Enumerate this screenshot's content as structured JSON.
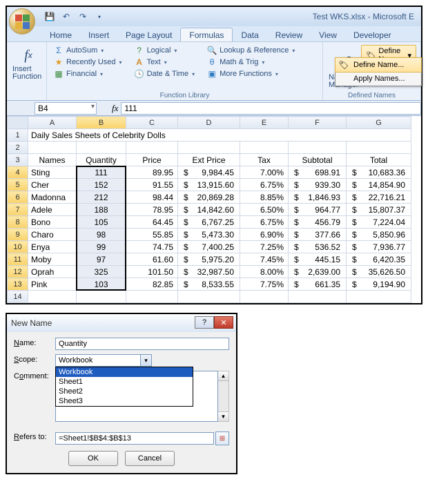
{
  "window": {
    "title": "Test WKS.xlsx - Microsoft E"
  },
  "tabs": {
    "home": "Home",
    "insert": "Insert",
    "pagelayout": "Page Layout",
    "formulas": "Formulas",
    "data": "Data",
    "review": "Review",
    "view": "View",
    "developer": "Developer"
  },
  "ribbon": {
    "insert_function": "Insert Function",
    "autosum": "AutoSum",
    "recently": "Recently Used",
    "financial": "Financial",
    "logical": "Logical",
    "text": "Text",
    "datetime": "Date & Time",
    "lookup": "Lookup & Reference",
    "mathtrig": "Math & Trig",
    "more": "More Functions",
    "group_lib": "Function Library",
    "name_manager": "Name Manager",
    "define_name": "Define Name",
    "define_name_menu": "Define Name...",
    "apply_names": "Apply Names...",
    "group_defnames": "Defined Names"
  },
  "fbar": {
    "namebox": "B4",
    "fx": "fx",
    "value": "111"
  },
  "columns": [
    "A",
    "B",
    "C",
    "D",
    "E",
    "F",
    "G"
  ],
  "sheet": {
    "title": "Daily Sales Sheets of Celebrity Dolls",
    "headers": {
      "A": "Names",
      "B": "Quantity",
      "C": "Price",
      "D": "Ext Price",
      "E": "Tax",
      "F": "Subtotal",
      "G": "Total"
    },
    "rows": [
      {
        "r": 4,
        "n": "Sting",
        "q": "111",
        "p": "89.95",
        "ext": "9,984.45",
        "tax": "7.00%",
        "sub": "698.91",
        "tot": "10,683.36"
      },
      {
        "r": 5,
        "n": "Cher",
        "q": "152",
        "p": "91.55",
        "ext": "13,915.60",
        "tax": "6.75%",
        "sub": "939.30",
        "tot": "14,854.90"
      },
      {
        "r": 6,
        "n": "Madonna",
        "q": "212",
        "p": "98.44",
        "ext": "20,869.28",
        "tax": "8.85%",
        "sub": "1,846.93",
        "tot": "22,716.21"
      },
      {
        "r": 7,
        "n": "Adele",
        "q": "188",
        "p": "78.95",
        "ext": "14,842.60",
        "tax": "6.50%",
        "sub": "964.77",
        "tot": "15,807.37"
      },
      {
        "r": 8,
        "n": "Bono",
        "q": "105",
        "p": "64.45",
        "ext": "6,767.25",
        "tax": "6.75%",
        "sub": "456.79",
        "tot": "7,224.04"
      },
      {
        "r": 9,
        "n": "Charo",
        "q": "98",
        "p": "55.85",
        "ext": "5,473.30",
        "tax": "6.90%",
        "sub": "377.66",
        "tot": "5,850.96"
      },
      {
        "r": 10,
        "n": "Enya",
        "q": "99",
        "p": "74.75",
        "ext": "7,400.25",
        "tax": "7.25%",
        "sub": "536.52",
        "tot": "7,936.77"
      },
      {
        "r": 11,
        "n": "Moby",
        "q": "97",
        "p": "61.60",
        "ext": "5,975.20",
        "tax": "7.45%",
        "sub": "445.15",
        "tot": "6,420.35"
      },
      {
        "r": 12,
        "n": "Oprah",
        "q": "325",
        "p": "101.50",
        "ext": "32,987.50",
        "tax": "8.00%",
        "sub": "2,639.00",
        "tot": "35,626.50"
      },
      {
        "r": 13,
        "n": "Pink",
        "q": "103",
        "p": "82.85",
        "ext": "8,533.55",
        "tax": "7.75%",
        "sub": "661.35",
        "tot": "9,194.90"
      }
    ]
  },
  "dialog": {
    "title": "New Name",
    "labels": {
      "name": "Name:",
      "scope": "Scope:",
      "comment": "Comment:",
      "refers": "Refers to:"
    },
    "name_value": "Quantity",
    "scope_value": "Workbook",
    "scope_options": [
      "Workbook",
      "Sheet1",
      "Sheet2",
      "Sheet3"
    ],
    "refers_value": "=Sheet1!$B$4:$B$13",
    "ok": "OK",
    "cancel": "Cancel",
    "dollar": "$"
  }
}
